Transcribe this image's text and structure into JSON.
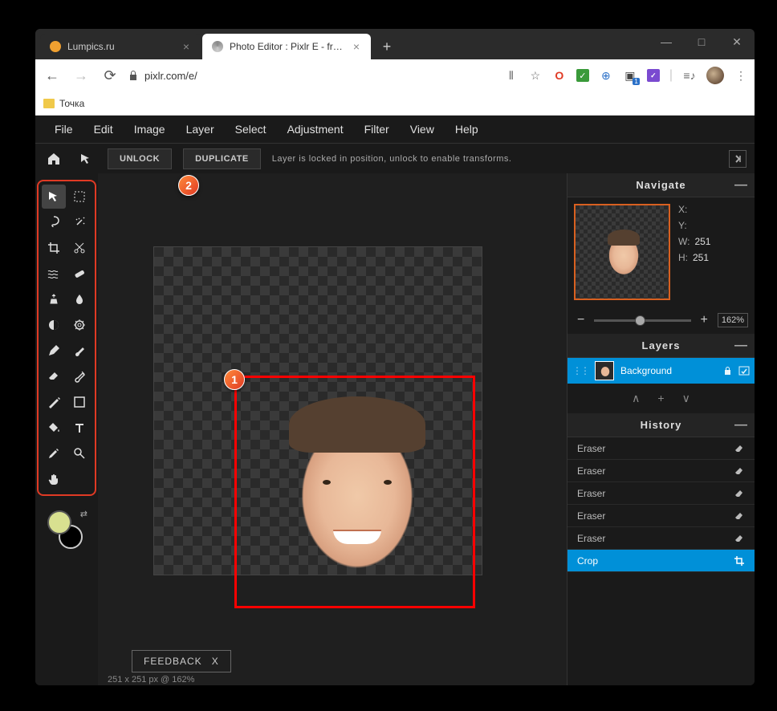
{
  "window": {
    "minimize": "—",
    "maximize": "□",
    "close": "✕"
  },
  "tabs": [
    {
      "title": "Lumpics.ru",
      "favicon": "#f0a030",
      "active": false
    },
    {
      "title": "Photo Editor : Pixlr E - free image",
      "favicon": "#888",
      "active": true
    }
  ],
  "url": "pixlr.com/e/",
  "bookmarks": [
    {
      "label": "Точка"
    }
  ],
  "menu": [
    "File",
    "Edit",
    "Image",
    "Layer",
    "Select",
    "Adjustment",
    "Filter",
    "View",
    "Help"
  ],
  "options_bar": {
    "unlock": "UNLOCK",
    "duplicate": "DUPLICATE",
    "message": "Layer is locked in position, unlock to enable transforms."
  },
  "tools": [
    [
      "arrow",
      "marquee"
    ],
    [
      "lasso",
      "wand"
    ],
    [
      "crop",
      "cut"
    ],
    [
      "liquify",
      "heal"
    ],
    [
      "clone",
      "blur"
    ],
    [
      "dodge",
      "sponge"
    ],
    [
      "pen",
      "brush"
    ],
    [
      "eraser",
      "smudge"
    ],
    [
      "draw",
      "shape"
    ],
    [
      "fill",
      "text"
    ],
    [
      "picker",
      "zoom"
    ],
    [
      "hand",
      ""
    ]
  ],
  "annotations": {
    "badge1": "1",
    "badge2": "2"
  },
  "colors": {
    "fg": "#d8e090",
    "bg": "#000000"
  },
  "navigate": {
    "title": "Navigate",
    "x_label": "X:",
    "x_val": "",
    "y_label": "Y:",
    "y_val": "",
    "w_label": "W:",
    "w_val": "251",
    "h_label": "H:",
    "h_val": "251",
    "zoom": "162%"
  },
  "layers": {
    "title": "Layers",
    "items": [
      {
        "name": "Background",
        "locked": true,
        "visible": true
      }
    ]
  },
  "history": {
    "title": "History",
    "items": [
      {
        "label": "Eraser",
        "icon": "eraser",
        "active": false
      },
      {
        "label": "Eraser",
        "icon": "eraser",
        "active": false
      },
      {
        "label": "Eraser",
        "icon": "eraser",
        "active": false
      },
      {
        "label": "Eraser",
        "icon": "eraser",
        "active": false
      },
      {
        "label": "Eraser",
        "icon": "eraser",
        "active": false
      },
      {
        "label": "Crop",
        "icon": "crop",
        "active": true
      }
    ]
  },
  "feedback": {
    "label": "FEEDBACK",
    "close": "X"
  },
  "status": "251 x 251 px @ 162%"
}
